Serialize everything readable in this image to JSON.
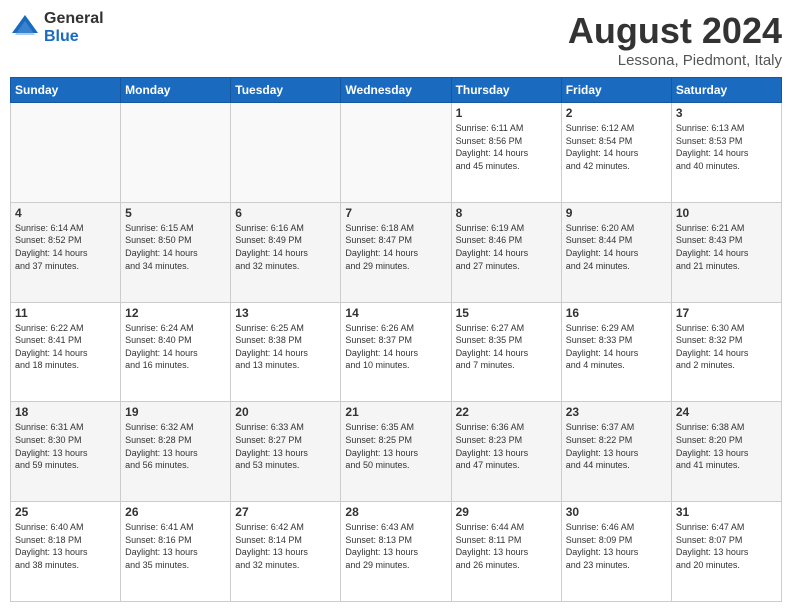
{
  "logo": {
    "general": "General",
    "blue": "Blue"
  },
  "title": {
    "month_year": "August 2024",
    "location": "Lessona, Piedmont, Italy"
  },
  "header_days": [
    "Sunday",
    "Monday",
    "Tuesday",
    "Wednesday",
    "Thursday",
    "Friday",
    "Saturday"
  ],
  "weeks": [
    [
      {
        "day": "",
        "info": ""
      },
      {
        "day": "",
        "info": ""
      },
      {
        "day": "",
        "info": ""
      },
      {
        "day": "",
        "info": ""
      },
      {
        "day": "1",
        "info": "Sunrise: 6:11 AM\nSunset: 8:56 PM\nDaylight: 14 hours\nand 45 minutes."
      },
      {
        "day": "2",
        "info": "Sunrise: 6:12 AM\nSunset: 8:54 PM\nDaylight: 14 hours\nand 42 minutes."
      },
      {
        "day": "3",
        "info": "Sunrise: 6:13 AM\nSunset: 8:53 PM\nDaylight: 14 hours\nand 40 minutes."
      }
    ],
    [
      {
        "day": "4",
        "info": "Sunrise: 6:14 AM\nSunset: 8:52 PM\nDaylight: 14 hours\nand 37 minutes."
      },
      {
        "day": "5",
        "info": "Sunrise: 6:15 AM\nSunset: 8:50 PM\nDaylight: 14 hours\nand 34 minutes."
      },
      {
        "day": "6",
        "info": "Sunrise: 6:16 AM\nSunset: 8:49 PM\nDaylight: 14 hours\nand 32 minutes."
      },
      {
        "day": "7",
        "info": "Sunrise: 6:18 AM\nSunset: 8:47 PM\nDaylight: 14 hours\nand 29 minutes."
      },
      {
        "day": "8",
        "info": "Sunrise: 6:19 AM\nSunset: 8:46 PM\nDaylight: 14 hours\nand 27 minutes."
      },
      {
        "day": "9",
        "info": "Sunrise: 6:20 AM\nSunset: 8:44 PM\nDaylight: 14 hours\nand 24 minutes."
      },
      {
        "day": "10",
        "info": "Sunrise: 6:21 AM\nSunset: 8:43 PM\nDaylight: 14 hours\nand 21 minutes."
      }
    ],
    [
      {
        "day": "11",
        "info": "Sunrise: 6:22 AM\nSunset: 8:41 PM\nDaylight: 14 hours\nand 18 minutes."
      },
      {
        "day": "12",
        "info": "Sunrise: 6:24 AM\nSunset: 8:40 PM\nDaylight: 14 hours\nand 16 minutes."
      },
      {
        "day": "13",
        "info": "Sunrise: 6:25 AM\nSunset: 8:38 PM\nDaylight: 14 hours\nand 13 minutes."
      },
      {
        "day": "14",
        "info": "Sunrise: 6:26 AM\nSunset: 8:37 PM\nDaylight: 14 hours\nand 10 minutes."
      },
      {
        "day": "15",
        "info": "Sunrise: 6:27 AM\nSunset: 8:35 PM\nDaylight: 14 hours\nand 7 minutes."
      },
      {
        "day": "16",
        "info": "Sunrise: 6:29 AM\nSunset: 8:33 PM\nDaylight: 14 hours\nand 4 minutes."
      },
      {
        "day": "17",
        "info": "Sunrise: 6:30 AM\nSunset: 8:32 PM\nDaylight: 14 hours\nand 2 minutes."
      }
    ],
    [
      {
        "day": "18",
        "info": "Sunrise: 6:31 AM\nSunset: 8:30 PM\nDaylight: 13 hours\nand 59 minutes."
      },
      {
        "day": "19",
        "info": "Sunrise: 6:32 AM\nSunset: 8:28 PM\nDaylight: 13 hours\nand 56 minutes."
      },
      {
        "day": "20",
        "info": "Sunrise: 6:33 AM\nSunset: 8:27 PM\nDaylight: 13 hours\nand 53 minutes."
      },
      {
        "day": "21",
        "info": "Sunrise: 6:35 AM\nSunset: 8:25 PM\nDaylight: 13 hours\nand 50 minutes."
      },
      {
        "day": "22",
        "info": "Sunrise: 6:36 AM\nSunset: 8:23 PM\nDaylight: 13 hours\nand 47 minutes."
      },
      {
        "day": "23",
        "info": "Sunrise: 6:37 AM\nSunset: 8:22 PM\nDaylight: 13 hours\nand 44 minutes."
      },
      {
        "day": "24",
        "info": "Sunrise: 6:38 AM\nSunset: 8:20 PM\nDaylight: 13 hours\nand 41 minutes."
      }
    ],
    [
      {
        "day": "25",
        "info": "Sunrise: 6:40 AM\nSunset: 8:18 PM\nDaylight: 13 hours\nand 38 minutes."
      },
      {
        "day": "26",
        "info": "Sunrise: 6:41 AM\nSunset: 8:16 PM\nDaylight: 13 hours\nand 35 minutes."
      },
      {
        "day": "27",
        "info": "Sunrise: 6:42 AM\nSunset: 8:14 PM\nDaylight: 13 hours\nand 32 minutes."
      },
      {
        "day": "28",
        "info": "Sunrise: 6:43 AM\nSunset: 8:13 PM\nDaylight: 13 hours\nand 29 minutes."
      },
      {
        "day": "29",
        "info": "Sunrise: 6:44 AM\nSunset: 8:11 PM\nDaylight: 13 hours\nand 26 minutes."
      },
      {
        "day": "30",
        "info": "Sunrise: 6:46 AM\nSunset: 8:09 PM\nDaylight: 13 hours\nand 23 minutes."
      },
      {
        "day": "31",
        "info": "Sunrise: 6:47 AM\nSunset: 8:07 PM\nDaylight: 13 hours\nand 20 minutes."
      }
    ]
  ]
}
